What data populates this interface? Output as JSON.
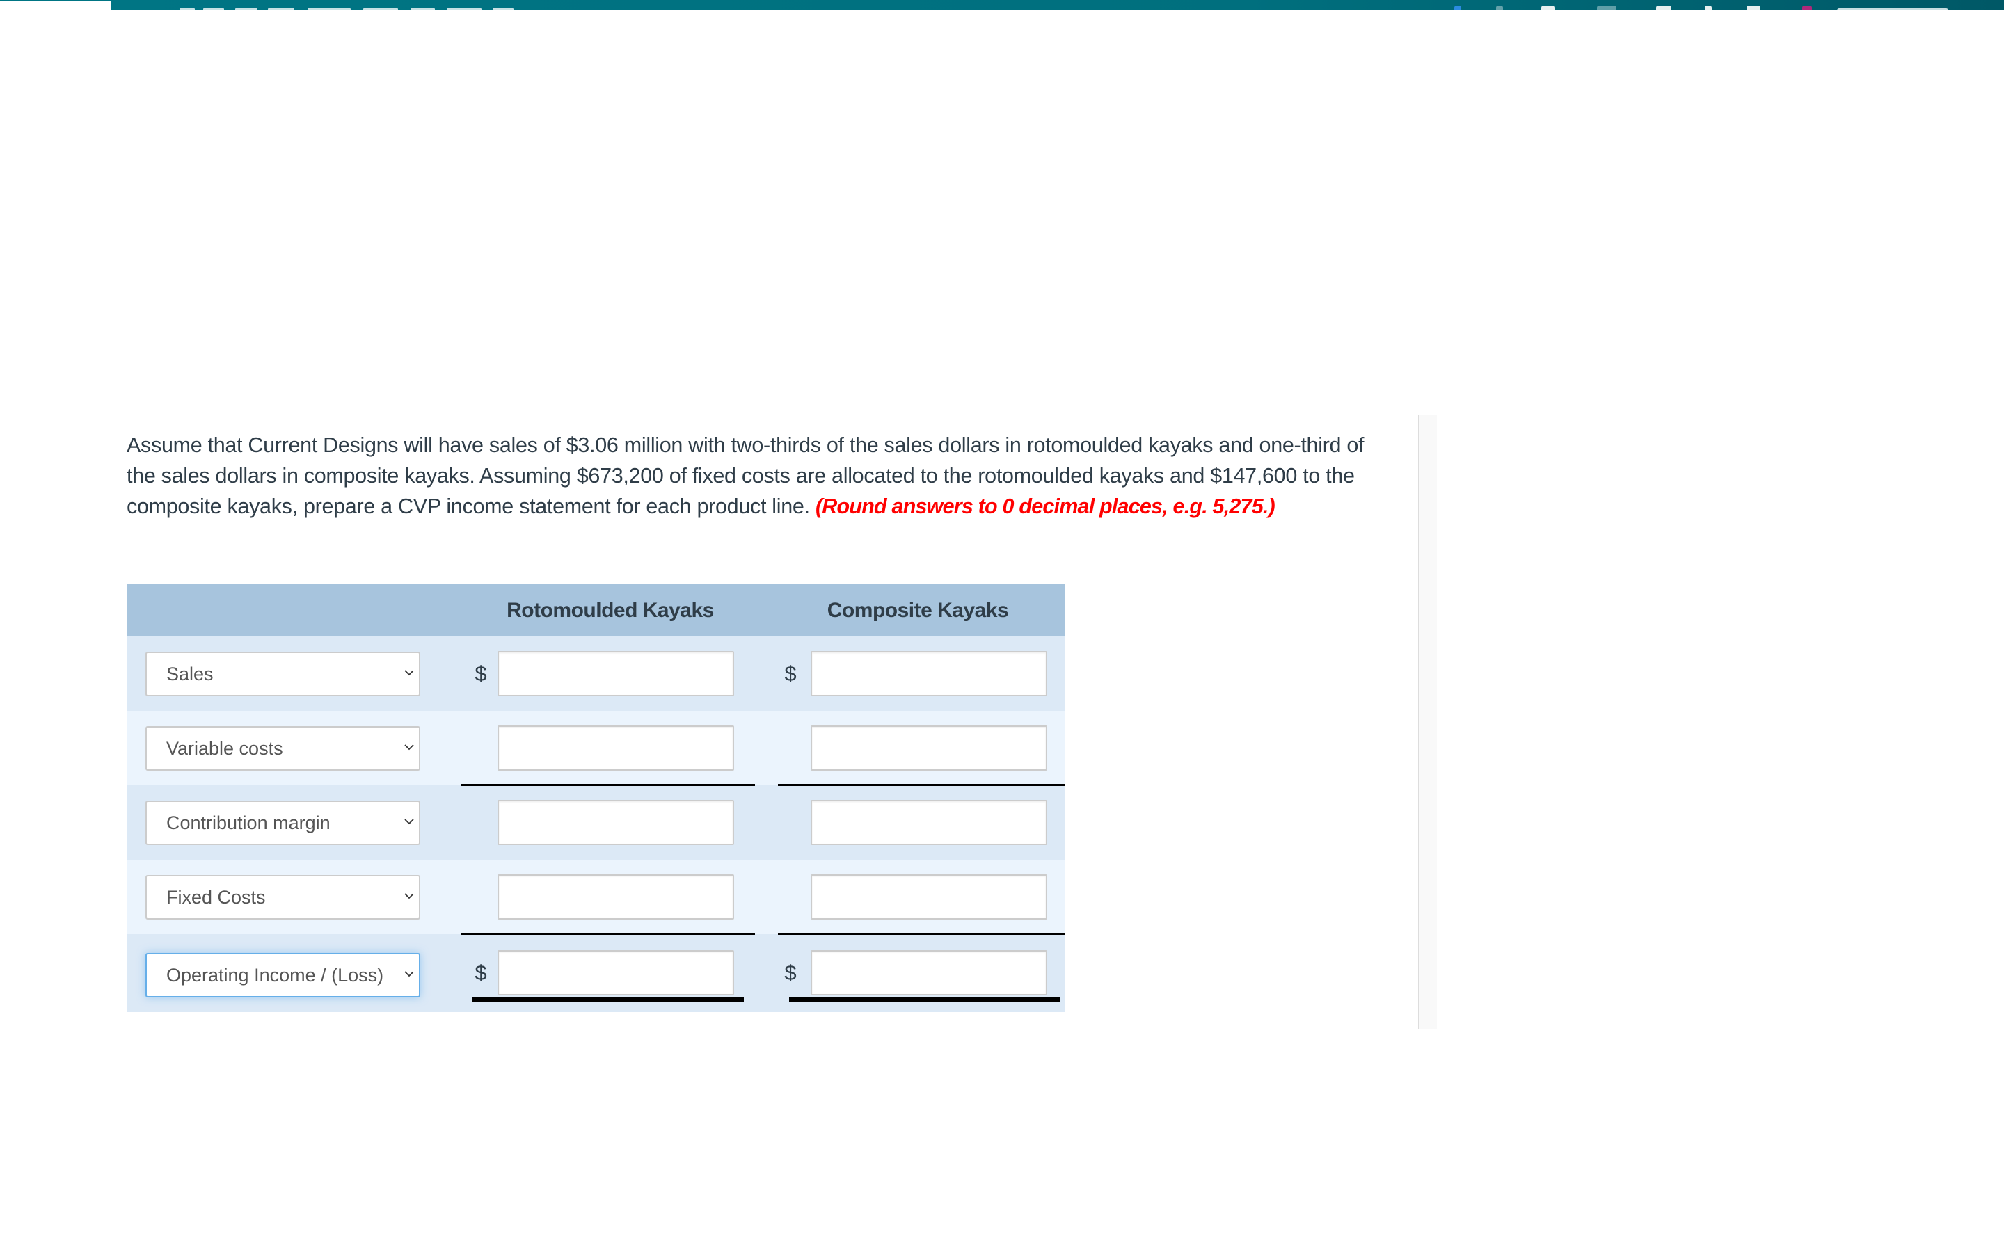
{
  "question": {
    "text": "Assume that Current Designs will have sales of $3.06 million with two-thirds of the sales dollars in rotomoulded kayaks and one-third of the sales dollars in composite kayaks. Assuming $673,200 of fixed costs are allocated to the rotomoulded kayaks and $147,600 to the composite kayaks, prepare a CVP income statement for each product line.",
    "hint": "(Round answers to 0 decimal places, e.g. 5,275.)"
  },
  "table": {
    "columns": [
      "Rotomoulded Kayaks",
      "Composite Kayaks"
    ],
    "currency_symbol": "$",
    "rows": [
      {
        "select_value": "Sales",
        "show_dollar": true,
        "rotomoulded_value": "",
        "composite_value": ""
      },
      {
        "select_value": "Variable costs",
        "show_dollar": false,
        "rotomoulded_value": "",
        "composite_value": ""
      },
      {
        "select_value": "Contribution margin",
        "show_dollar": false,
        "rotomoulded_value": "",
        "composite_value": ""
      },
      {
        "select_value": "Fixed Costs",
        "show_dollar": false,
        "rotomoulded_value": "",
        "composite_value": ""
      },
      {
        "select_value": "Operating Income / (Loss)",
        "show_dollar": true,
        "rotomoulded_value": "",
        "composite_value": ""
      }
    ]
  },
  "icons": {
    "dropdown": "chevron-down-icon"
  },
  "colors": {
    "menubar": "#007584",
    "header": "#a7c4dd",
    "row_odd": "#dce9f6",
    "row_even": "#ebf4fd",
    "hint_red": "#ff0000",
    "focus_blue": "#66afe9"
  }
}
